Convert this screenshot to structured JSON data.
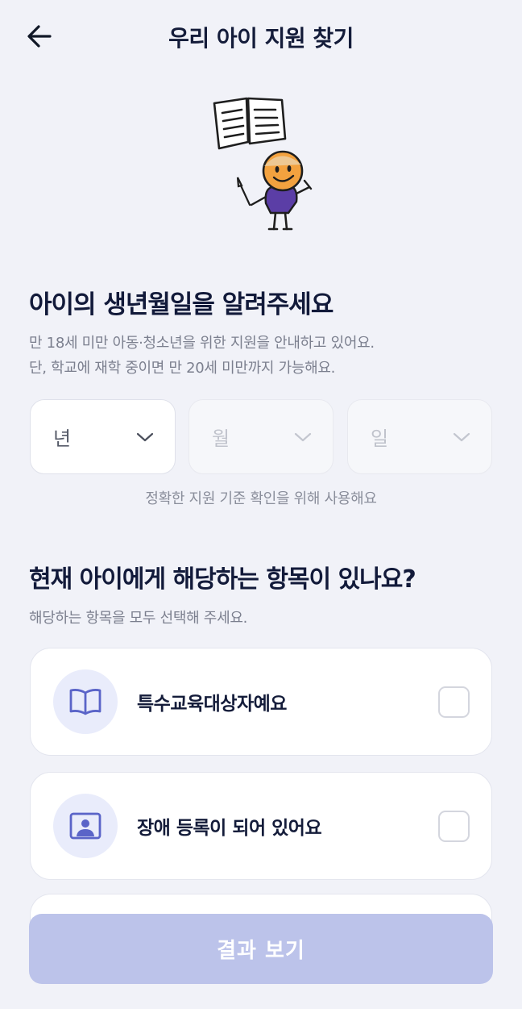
{
  "header": {
    "title": "우리 아이 지원 찾기",
    "back_icon": "arrow-left-icon"
  },
  "illustration": {
    "name": "child-with-book-illustration"
  },
  "birth": {
    "title": "아이의 생년월일을 알려주세요",
    "desc_line1": "만 18세 미만 아동·청소년을 위한 지원을 안내하고 있어요.",
    "desc_line2": "단, 학교에 재학 중이면 만 20세 미만까지 가능해요.",
    "year_label": "년",
    "month_label": "월",
    "day_label": "일",
    "hint": "정확한 지원 기준 확인을 위해 사용해요"
  },
  "conditions": {
    "title": "현재 아이에게 해당하는 항목이 있나요?",
    "desc": "해당하는 항목을 모두 선택해 주세요.",
    "items": [
      {
        "label": "특수교육대상자예요",
        "icon": "book-icon",
        "checked": false
      },
      {
        "label": "장애 등록이 되어 있어요",
        "icon": "id-card-icon",
        "checked": false
      }
    ]
  },
  "cta": {
    "label": "결과 보기",
    "enabled": false
  },
  "colors": {
    "accent": "#5a64c8",
    "cta_disabled": "#bcc3ea",
    "background": "#f1f2f8"
  }
}
